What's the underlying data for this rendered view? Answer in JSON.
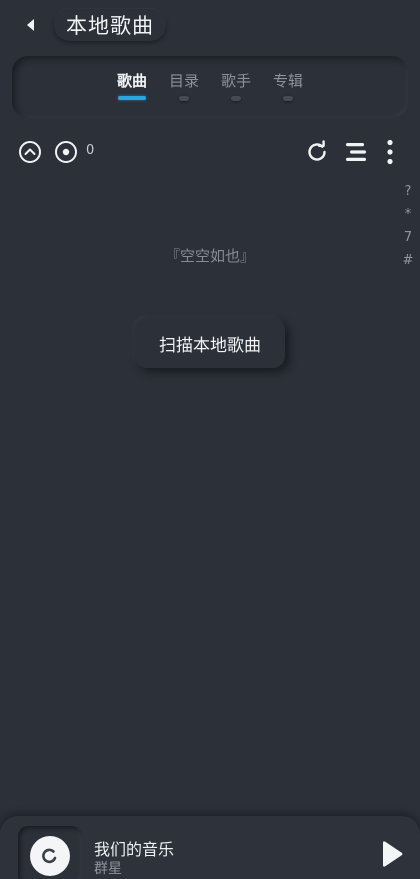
{
  "header": {
    "title": "本地歌曲",
    "back_icon": "back-arrow-icon"
  },
  "tabs": [
    {
      "label": "歌曲",
      "active": true
    },
    {
      "label": "目录",
      "active": false
    },
    {
      "label": "歌手",
      "active": false
    },
    {
      "label": "专辑",
      "active": false
    }
  ],
  "toolbar": {
    "song_count": "0",
    "icons": [
      "scroll-up-icon",
      "locate-current-icon",
      "refresh-icon",
      "sort-list-icon",
      "more-vert-icon"
    ]
  },
  "side_index": [
    "?",
    "*",
    "7",
    "#"
  ],
  "empty_state": {
    "message": "『空空如也』",
    "scan_button": "扫描本地歌曲"
  },
  "player": {
    "title": "我们的音乐",
    "artist": "群星",
    "play_icon": "play-icon"
  },
  "colors": {
    "background": "#2b3039",
    "accent": "#29a6e0",
    "text_primary": "#f1f3f5",
    "text_secondary": "#8b939e"
  }
}
